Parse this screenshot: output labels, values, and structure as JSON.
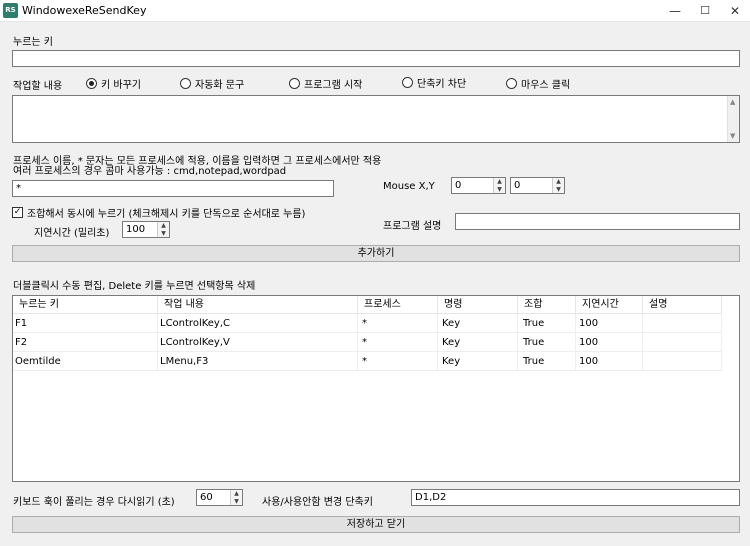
{
  "window": {
    "icon_text": "RS",
    "title": "WindowexeReSendKey",
    "min": "—",
    "max": "☐",
    "close": "✕"
  },
  "key_label": "누르는 키",
  "key_value": "",
  "task_label": "작업할 내용",
  "task_options": [
    "키 바꾸기",
    "자동화 문구",
    "프로그램 시작",
    "단축키 차단",
    "마우스 클릭"
  ],
  "task_selected": 0,
  "process_help1": "프로세스 이름, * 문자는 모든 프로세스에 적용, 이름을 입력하면 그 프로세스에서만 적용",
  "process_help2": "여러 프로세스의 경우 콤마 사용가능 : cmd,notepad,wordpad",
  "process_value": "*",
  "mouse_label": "Mouse X,Y",
  "mouse_x": "0",
  "mouse_y": "0",
  "combo_label": "조합해서 동시에 누르기 (체크해제시 키를 단독으로 순서대로 누름)",
  "combo_checked": true,
  "delay_label": "지연시간 (밀리초)",
  "delay_value": "100",
  "desc_label": "프로그램 설명",
  "desc_value": "",
  "add_button": "추가하기",
  "grid_hint": "더블클릭시 수동 편집, Delete 키를 누르면 선택항목 삭제",
  "grid": {
    "columns": [
      "누르는 키",
      "작업 내용",
      "프로세스",
      "명령",
      "조합",
      "지연시간",
      "설명"
    ],
    "rows": [
      [
        "F1",
        "LControlKey,C",
        "*",
        "Key",
        "True",
        "100",
        ""
      ],
      [
        "F2",
        "LControlKey,V",
        "*",
        "Key",
        "True",
        "100",
        ""
      ],
      [
        "Oemtilde",
        "LMenu,F3",
        "*",
        "Key",
        "True",
        "100",
        ""
      ]
    ]
  },
  "reload_label": "키보드 훅이 풀리는 경우 다시읽기 (초)",
  "reload_value": "60",
  "toggle_label": "사용/사용안함 변경 단축키",
  "toggle_value": "D1,D2",
  "save_button": "저장하고 닫기"
}
